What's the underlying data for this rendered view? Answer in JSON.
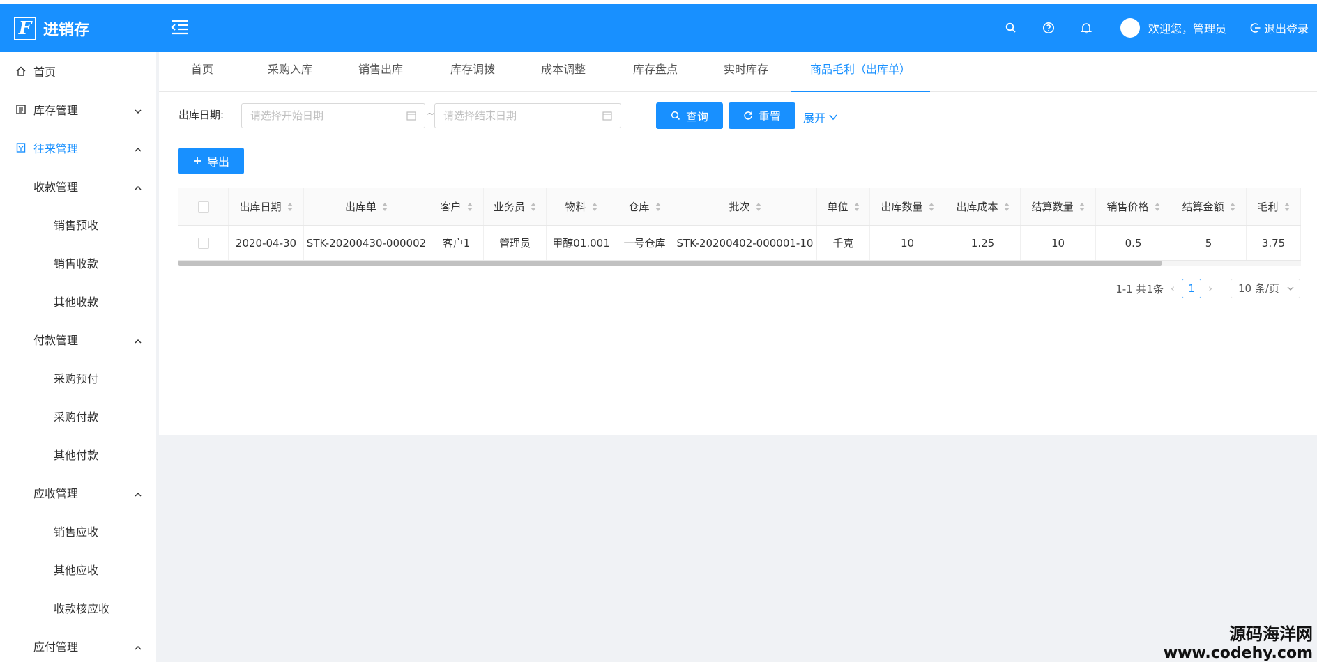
{
  "app": {
    "title": "进销存",
    "logo_letter": "F"
  },
  "header": {
    "welcome": "欢迎您，管理员",
    "logout": "退出登录"
  },
  "sidebar": {
    "items": [
      {
        "label": "首页",
        "icon": "home-icon",
        "level": 0
      },
      {
        "label": "库存管理",
        "icon": "inventory-icon",
        "level": 0,
        "chevron": "down"
      },
      {
        "label": "往来管理",
        "icon": "accounts-icon",
        "level": 0,
        "chevron": "up",
        "active": true
      },
      {
        "label": "收款管理",
        "level": 1,
        "chevron": "up"
      },
      {
        "label": "销售预收",
        "level": 2
      },
      {
        "label": "销售收款",
        "level": 2
      },
      {
        "label": "其他收款",
        "level": 2
      },
      {
        "label": "付款管理",
        "level": 1,
        "chevron": "up"
      },
      {
        "label": "采购预付",
        "level": 2
      },
      {
        "label": "采购付款",
        "level": 2
      },
      {
        "label": "其他付款",
        "level": 2
      },
      {
        "label": "应收管理",
        "level": 1,
        "chevron": "up"
      },
      {
        "label": "销售应收",
        "level": 2
      },
      {
        "label": "其他应收",
        "level": 2
      },
      {
        "label": "收款核应收",
        "level": 2
      },
      {
        "label": "应付管理",
        "level": 1,
        "chevron": "up"
      }
    ]
  },
  "tabs": [
    {
      "label": "首页"
    },
    {
      "label": "采购入库"
    },
    {
      "label": "销售出库"
    },
    {
      "label": "库存调拨"
    },
    {
      "label": "成本调整"
    },
    {
      "label": "库存盘点"
    },
    {
      "label": "实时库存"
    },
    {
      "label": "商品毛利（出库单）",
      "active": true
    }
  ],
  "filter": {
    "label": "出库日期:",
    "start_placeholder": "请选择开始日期",
    "end_placeholder": "请选择结束日期",
    "separator": "~",
    "query_label": "查询",
    "reset_label": "重置",
    "expand_label": "展开"
  },
  "toolbar": {
    "export_label": "导出"
  },
  "table": {
    "columns": [
      "出库日期",
      "出库单",
      "客户",
      "业务员",
      "物料",
      "仓库",
      "批次",
      "单位",
      "出库数量",
      "出库成本",
      "结算数量",
      "销售价格",
      "结算金额",
      "毛利"
    ],
    "rows": [
      [
        "2020-04-30",
        "STK-20200430-000002",
        "客户1",
        "管理员",
        "甲醇01.001",
        "一号仓库",
        "STK-20200402-000001-10",
        "千克",
        "10",
        "1.25",
        "10",
        "0.5",
        "5",
        "3.75"
      ]
    ]
  },
  "pagination": {
    "summary": "1-1 共1条",
    "current_page": "1",
    "page_size": "10 条/页"
  },
  "watermark": {
    "line1": "源码海洋网",
    "line2": "www.codehy.com"
  },
  "colors": {
    "primary": "#1890ff",
    "sidebar_bg": "#ffffff",
    "content_bg": "#f0f2f5"
  }
}
